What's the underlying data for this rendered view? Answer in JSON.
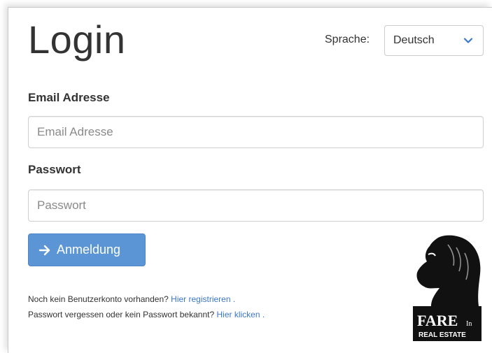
{
  "header": {
    "title": "Login",
    "language_label": "Sprache:",
    "language_value": "Deutsch"
  },
  "form": {
    "email_label": "Email Adresse",
    "email_placeholder": "Email Adresse",
    "email_value": "",
    "password_label": "Passwort",
    "password_placeholder": "Passwort",
    "password_value": "",
    "submit_label": "Anmeldung"
  },
  "footer": {
    "register_text": "Noch kein Benutzerkonto vorhanden?",
    "register_link": "Hier registrieren",
    "register_suffix": ".",
    "forgot_text": "Passwort vergessen oder kein Passwort bekannt?",
    "forgot_link": "Hier klicken",
    "forgot_suffix": "."
  },
  "logo": {
    "brand": "FARE",
    "brand_suffix": "In",
    "subtitle": "REAL ESTATE"
  },
  "colors": {
    "primary_button": "#5c95d6",
    "link": "#3a78c9",
    "chevron": "#3a78c9"
  },
  "icons": {
    "submit": "arrow-right-icon",
    "select": "chevron-down-icon",
    "logo": "knight-horse-logo"
  }
}
